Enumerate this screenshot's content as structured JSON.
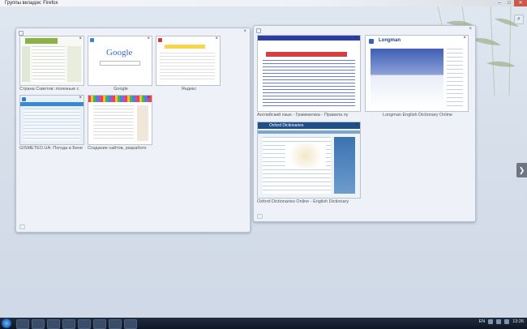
{
  "window": {
    "title": "Группы вкладок: Firefox",
    "minimize": "–",
    "maximize": "□",
    "close": "✕"
  },
  "search_icon": "search-icon",
  "group1": {
    "close": "×",
    "tabs": [
      {
        "title": "Страна Советов: полезные с",
        "close": "×"
      },
      {
        "title": "Google",
        "close": "×"
      },
      {
        "title": "Яндекс",
        "close": "×"
      },
      {
        "title": "GISMETEO.UA: Погода в Бене",
        "close": "×"
      },
      {
        "title": "Создание сайтов, разработк",
        "close": "×"
      }
    ]
  },
  "group2": {
    "close": "×",
    "tabs": [
      {
        "title": "Английский язык - Грамматика - Правила пу",
        "close": "×"
      },
      {
        "title": "Longman English Dictionary Online",
        "close": "×"
      },
      {
        "title": "Oxford Dictionaries Online - English Dictionary",
        "close": "×"
      }
    ]
  },
  "thumbnails": {
    "google_logo": "Google",
    "longman_logo": "Longman",
    "oxford_logo": "Oxford Dictionaries"
  },
  "next_arrow": "❯",
  "taskbar": {
    "lang": "EN",
    "time": "13:26"
  }
}
